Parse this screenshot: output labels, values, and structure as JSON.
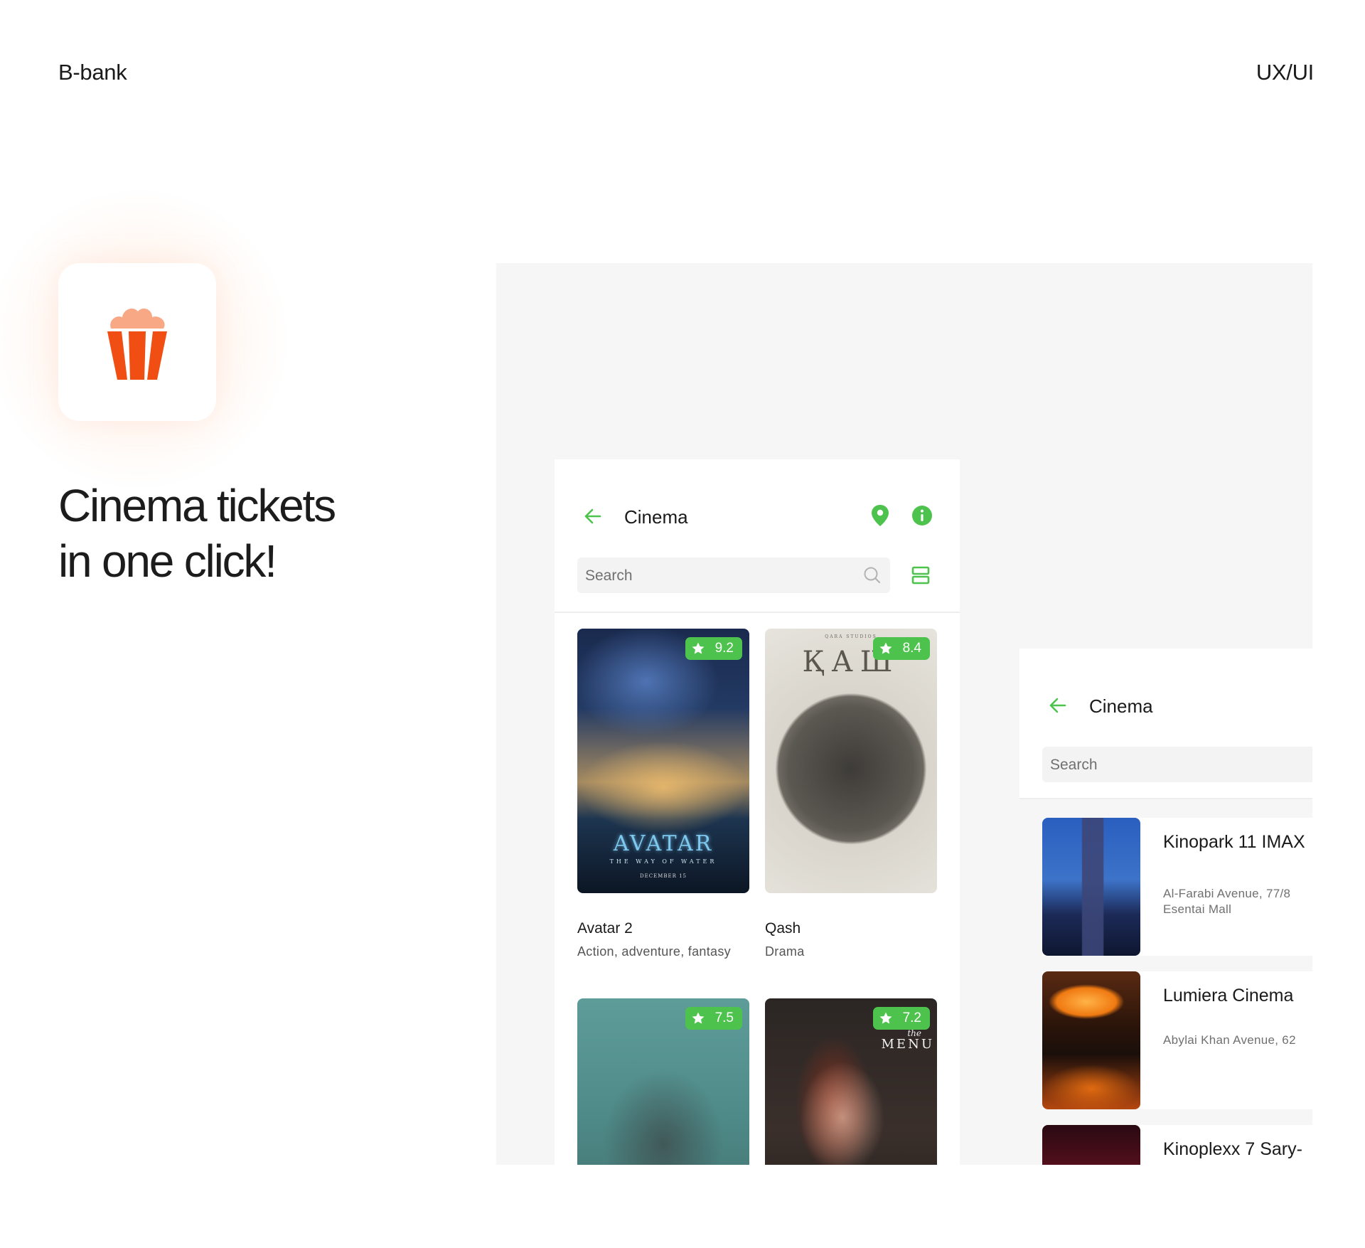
{
  "header": {
    "brand": "B-bank",
    "tag": "UX/UI"
  },
  "hero": {
    "headline_line1": "Cinema tickets",
    "headline_line2": "in one click!",
    "icon": "popcorn-icon"
  },
  "colors": {
    "accent_green": "#4DC34D",
    "popcorn_orange": "#F04E12",
    "popcorn_top": "#F9A886",
    "canvas_bg": "#F6F6F6"
  },
  "movies_screen": {
    "title": "Cinema",
    "search_placeholder": "Search",
    "icons": [
      "back-arrow-icon",
      "location-pin-icon",
      "info-icon",
      "search-icon",
      "list-view-icon"
    ],
    "movies": [
      {
        "title": "Avatar 2",
        "genre": "Action, adventure, fantasy",
        "rating": "9.2",
        "poster_text": "AVATAR",
        "poster_sub": "THE WAY OF WATER",
        "poster_date": "DECEMBER 15"
      },
      {
        "title": "Qash",
        "genre": "Drama",
        "rating": "8.4",
        "poster_text": "ҚАШ",
        "poster_studio": "QARA STUDIOS"
      },
      {
        "title": "",
        "genre": "",
        "rating": "7.5"
      },
      {
        "title": "",
        "genre": "",
        "rating": "7.2",
        "poster_the": "the",
        "poster_text": "MENU"
      }
    ]
  },
  "cinemas_screen": {
    "title": "Cinema",
    "search_placeholder": "Search",
    "cinemas": [
      {
        "name": "Kinopark 11 IMAX",
        "address_line1": "Al-Farabi Avenue, 77/8",
        "address_line2": "Esentai Mall"
      },
      {
        "name": "Lumiera Cinema",
        "address_line1": "Abylai Khan Avenue, 62",
        "address_line2": ""
      },
      {
        "name": "Kinoplexx 7 Sary-",
        "address_line1": "",
        "address_line2": ""
      }
    ]
  }
}
